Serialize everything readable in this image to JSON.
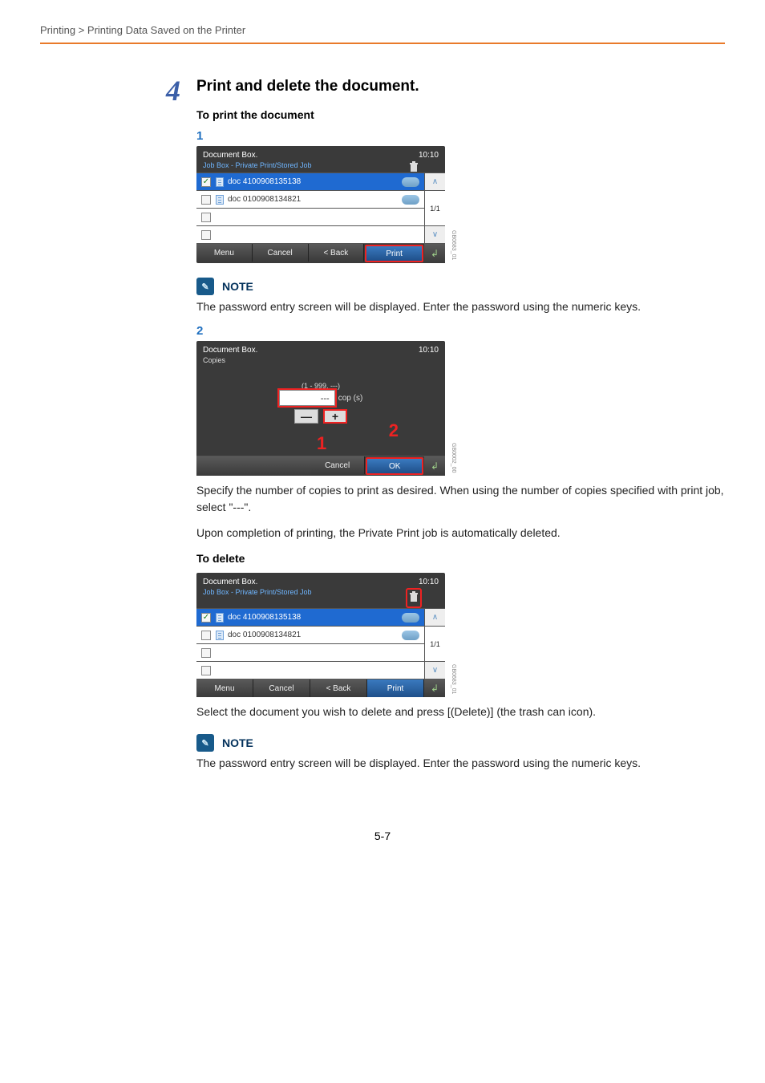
{
  "breadcrumb": {
    "section": "Printing",
    "sep": ">",
    "sub": "Printing Data Saved on the Printer"
  },
  "step": {
    "num": "4",
    "title": "Print and delete the document."
  },
  "sub_print": "To print the document",
  "seq1": "1",
  "panel1": {
    "title": "Document Box.",
    "time": "10:10",
    "sub": "Job Box - Private Print/Stored Job",
    "row1": "doc 4100908135138",
    "row2": "doc 0100908134821",
    "page": "1/1",
    "menu": "Menu",
    "cancel": "Cancel",
    "back": "< Back",
    "print": "Print",
    "sidecode": "GB0683_01"
  },
  "note1": {
    "label": "NOTE",
    "text": "The password entry screen will be displayed. Enter the password using the numeric keys."
  },
  "seq2": "2",
  "panel2": {
    "title": "Document Box.",
    "time": "10:10",
    "sub": "Copies",
    "range": "(1 - 999, ---)",
    "value": "---",
    "unit": "cop (s)",
    "minus": "—",
    "plus": "+",
    "cancel": "Cancel",
    "ok": "OK",
    "callout1": "1",
    "callout2": "2",
    "sidecode": "GB0002_00"
  },
  "after_copies_1": "Specify the number of copies to print as desired. When using the number of copies specified with print job, select \"---\".",
  "after_copies_2": "Upon completion of printing, the Private Print job is automatically deleted.",
  "sub_delete": "To delete",
  "panel3": {
    "title": "Document Box.",
    "time": "10:10",
    "sub": "Job Box - Private Print/Stored Job",
    "row1": "doc 4100908135138",
    "row2": "doc 0100908134821",
    "page": "1/1",
    "menu": "Menu",
    "cancel": "Cancel",
    "back": "< Back",
    "print": "Print",
    "sidecode": "GB0683_01"
  },
  "after_delete": "Select the document you wish to delete and press [(Delete)] (the trash can icon).",
  "note2": {
    "label": "NOTE",
    "text": "The password entry screen will be displayed. Enter the password using the numeric keys."
  },
  "pagenum": "5-7"
}
